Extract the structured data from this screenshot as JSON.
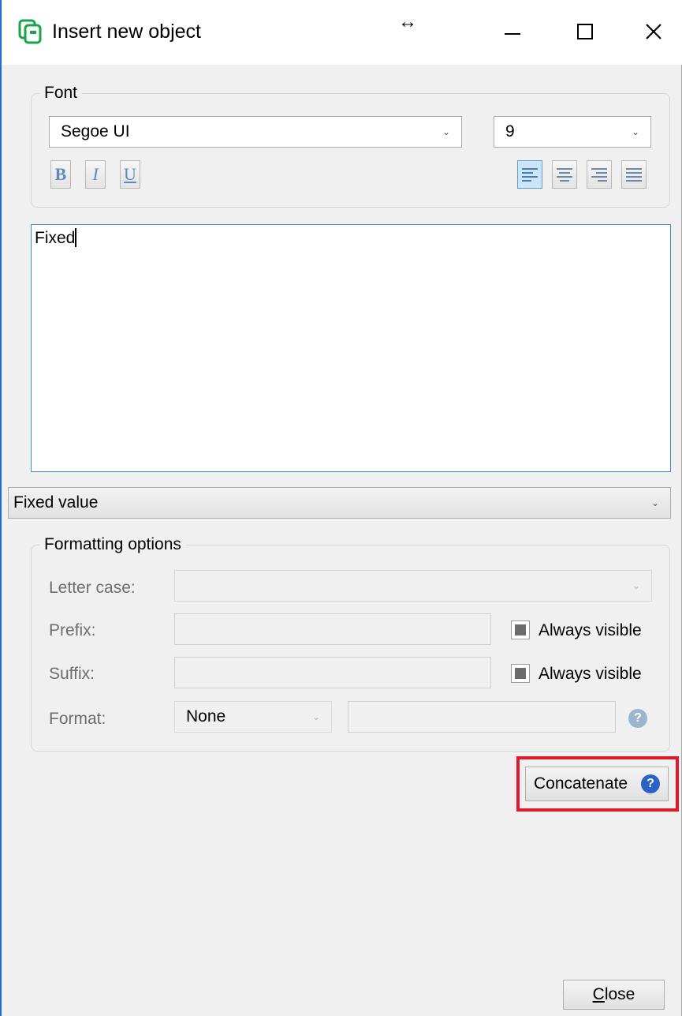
{
  "window": {
    "title": "Insert new object",
    "icons": {
      "app": "app-logo-icon",
      "resize": "horizontal-resize-icon",
      "minimize": "minimize-icon",
      "maximize": "maximize-icon",
      "close": "close-icon"
    },
    "colors": {
      "accent": "#1e6fd0",
      "highlight": "#e1182a",
      "help": "#2a63c4"
    }
  },
  "font_group": {
    "label": "Font",
    "font_family": "Segoe UI",
    "font_size": "9",
    "style_buttons": {
      "bold": "B",
      "italic": "I",
      "underline": "U"
    },
    "alignment": {
      "selected": "left",
      "options": [
        "left",
        "center",
        "right",
        "justify"
      ]
    }
  },
  "text_content": "Fixed",
  "source_type": "Fixed value",
  "formatting": {
    "label": "Formatting options",
    "letter_case": {
      "label": "Letter case:",
      "value": ""
    },
    "prefix": {
      "label": "Prefix:",
      "value": "",
      "always_visible_label": "Always visible"
    },
    "suffix": {
      "label": "Suffix:",
      "value": "",
      "always_visible_label": "Always visible"
    },
    "format": {
      "label": "Format:",
      "type": "None",
      "value": ""
    }
  },
  "buttons": {
    "concatenate": "Concatenate",
    "close_first": "C",
    "close_rest": "lose"
  }
}
